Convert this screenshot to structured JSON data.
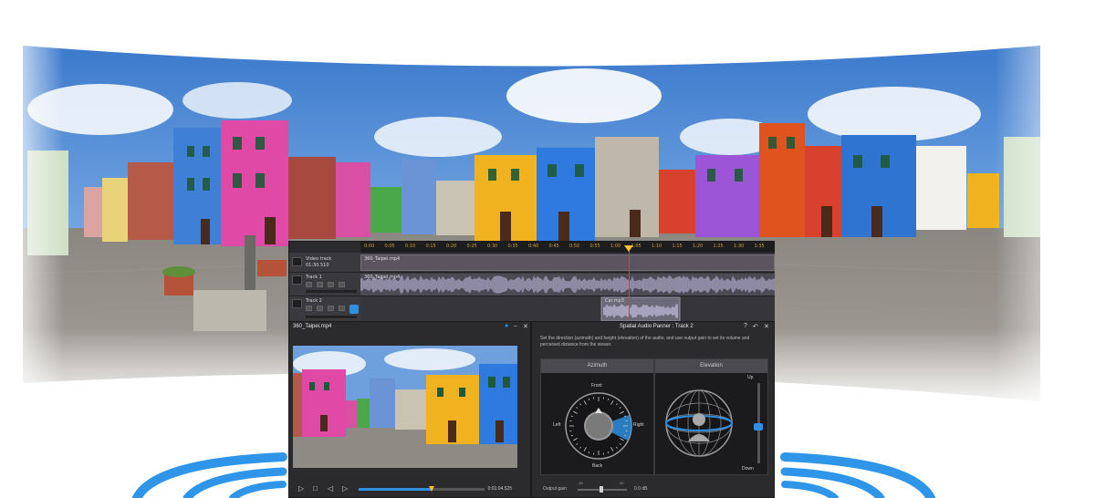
{
  "timeline": {
    "ruler_ticks": [
      "0:00",
      "0:05",
      "0:10",
      "0:15",
      "0:20",
      "0:25",
      "0:30",
      "0:35",
      "0:40",
      "0:45",
      "0:50",
      "0:55",
      "1:00",
      "1:05",
      "1:10",
      "1:15",
      "1:20",
      "1:25",
      "1:30",
      "1:35"
    ],
    "video_track_label": "Video track",
    "video_track_time": "01:30.510",
    "video_clip": "360_Taipei.mp4",
    "track1_label": "Track 1",
    "track1_clip": "360_Taipei.mp4",
    "track2_label": "Track 2",
    "track2_clip": "Car.mp3"
  },
  "preview": {
    "title": "360_Taipei.mp4",
    "time": "0:01:04.525",
    "progress": 0.58
  },
  "panner": {
    "title": "Spatial Audio Panner : Track 2",
    "description": "Set the direction (azimuth) and height (elevation) of the audio, and use output gain to set its volume and perceived distance from the viewer.",
    "azimuth_label": "Azimuth",
    "elevation_label": "Elevation",
    "front_label": "Front",
    "back_label": "Back",
    "left_label": "Left",
    "right_label": "Right",
    "up_label": "Up",
    "down_label": "Down",
    "output_gain_label": "Output gain",
    "output_gain_value": "0.0 dB",
    "gain_min": "-20",
    "gain_max": "20"
  },
  "colors": {
    "accent": "#2f8fe0",
    "playhead": "#e23b3b",
    "ruler_text": "#c9a23a"
  }
}
